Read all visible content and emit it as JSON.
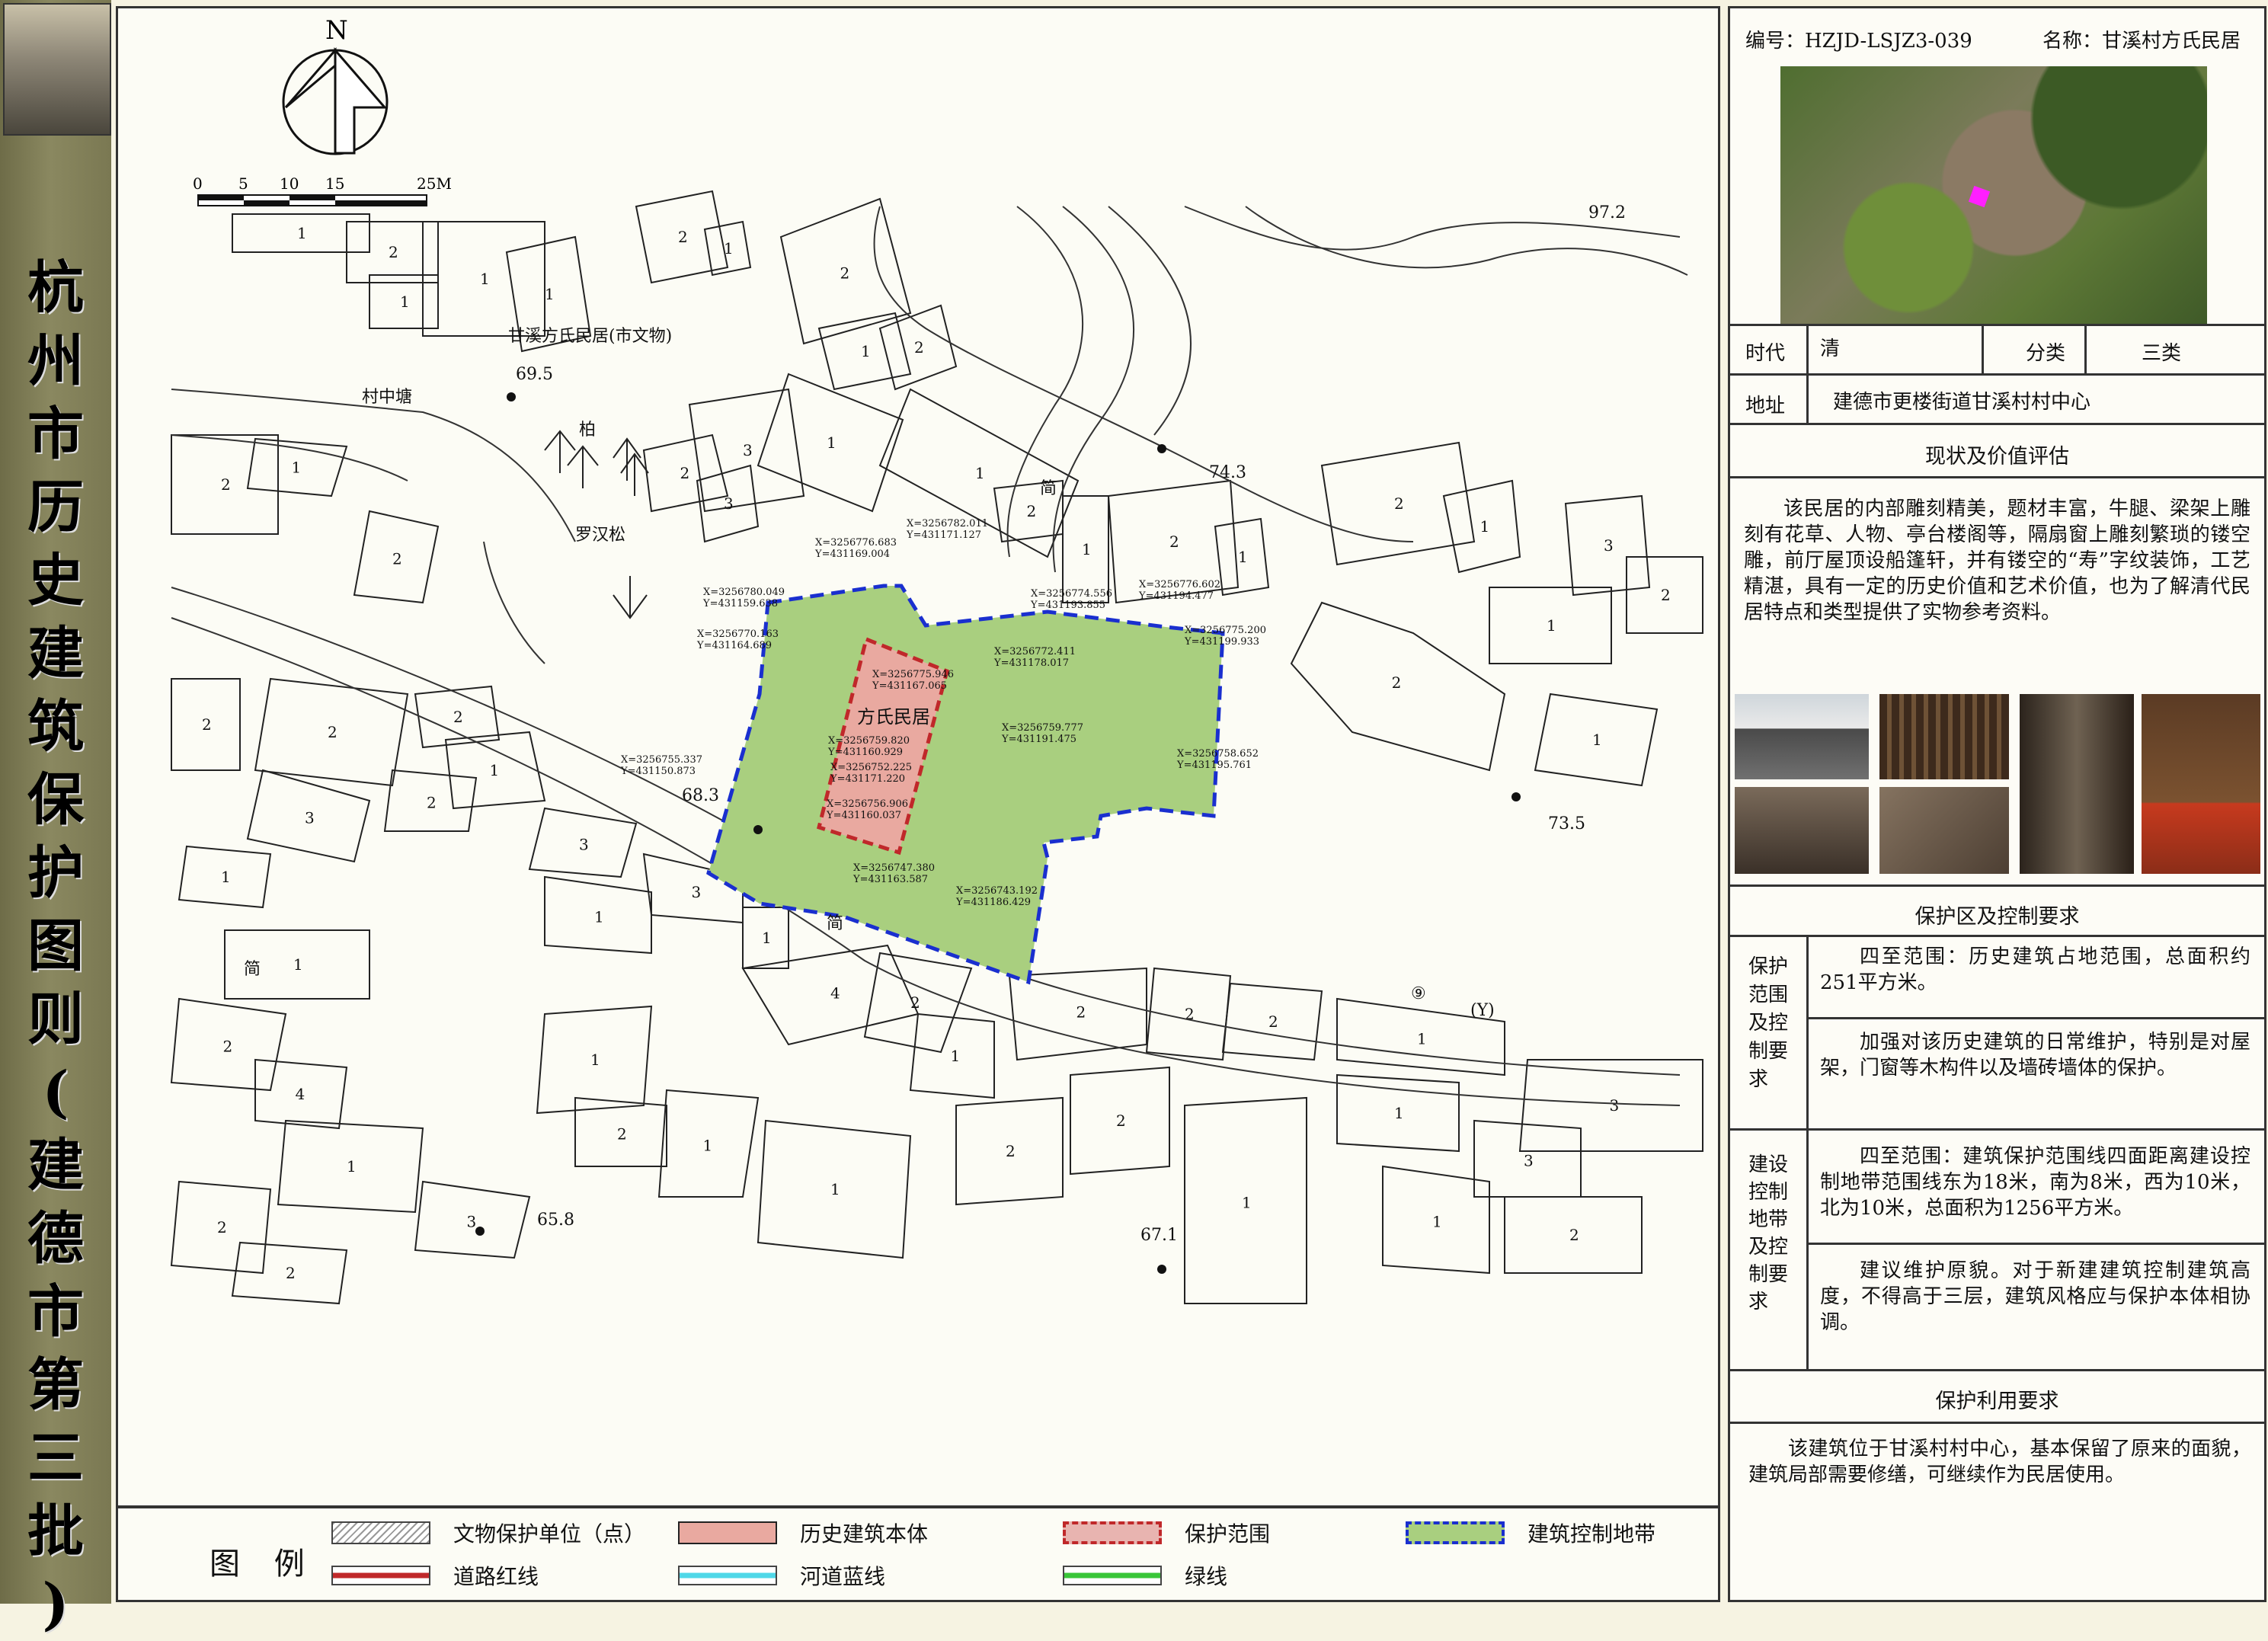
{
  "strip": {
    "title_chars": [
      "杭",
      "州",
      "市",
      "历",
      "史",
      "建",
      "筑",
      "保",
      "护",
      "图",
      "则",
      "(",
      "建",
      "德",
      "市",
      "第",
      "三",
      "批",
      ")"
    ]
  },
  "map": {
    "north": "N",
    "scale": {
      "ticks": [
        "0",
        "5",
        "10",
        "15"
      ],
      "end": "25M"
    },
    "place_labels": {
      "heritage_site": "甘溪方氏民居(市文物)",
      "pond": "村中塘",
      "arhat_pine": "罗汉松",
      "cypress": "柏",
      "building": "方氏民居",
      "jian1": "简",
      "jian2": "简",
      "jian3": "简",
      "road_num": "⑨",
      "road_y": "(Y)"
    },
    "elevations": [
      "69.5",
      "74.3",
      "97.2",
      "73.5",
      "68.3",
      "65.8",
      "67.1"
    ],
    "coords": [
      "X=3256782.011\nY=431171.127",
      "X=3256776.683\nY=431169.004",
      "X=3256780.049\nY=431159.638",
      "X=3256770.163\nY=431164.689",
      "X=3256774.556\nY=431193.855",
      "X=3256776.602\nY=431194.477",
      "X=3256775.200\nY=431199.933",
      "X=3256775.946\nY=431167.065",
      "X=3256772.411\nY=431178.017",
      "X=3256759.777\nY=431191.475",
      "X=3256758.652\nY=431195.761",
      "X=3256755.337\nY=431150.873",
      "X=3256759.820\nY=431160.929",
      "X=3256752.225\nY=431171.220",
      "X=3256756.906\nY=431160.037",
      "X=3256747.380\nY=431163.587",
      "X=3256743.192\nY=431186.429"
    ]
  },
  "legend": {
    "title": "图 例",
    "items": [
      {
        "label": "文物保护单位（点）"
      },
      {
        "label": "历史建筑本体"
      },
      {
        "label": "保护范围"
      },
      {
        "label": "建筑控制地带"
      },
      {
        "label": "道路红线"
      },
      {
        "label": "河道蓝线"
      },
      {
        "label": "绿线"
      }
    ],
    "colors": {
      "body": "#e9a9a0",
      "body_border": "#222",
      "protect": "#e8b4b0",
      "protect_border": "#c0282a",
      "control": "#a9cf7f",
      "control_border": "#1a2fcf",
      "road": "#c0282a",
      "river": "#4fd8e8",
      "green": "#39c639"
    }
  },
  "info": {
    "code": "编号：HZJD-LSJZ3-039",
    "name": "名称：甘溪村方氏民居",
    "era_label": "时代",
    "era_value": "清",
    "class_label": "分类",
    "class_value": "三类",
    "addr_label": "地址",
    "addr_value": "建德市更楼街道甘溪村村中心",
    "status_title": "现状及价值评估",
    "status_text": "该民居的内部雕刻精美，题材丰富，牛腿、梁架上雕刻有花草、人物、亭台楼阁等，隔扇窗上雕刻繁琐的镂空雕，前厅屋顶设船篷轩，并有镂空的“寿”字纹装饰，工艺精湛，具有一定的历史价值和艺术价值，也为了解清代民居特点和类型提供了实物参考资料。",
    "zone_title": "保护区及控制要求",
    "protect_label": "保护范围及控制要求",
    "protect_text1": "四至范围：历史建筑占地范围，总面积约251平方米。",
    "protect_text2": "加强对该历史建筑的日常维护，特别是对屋架，门窗等木构件以及墙砖墙体的保护。",
    "control_label": "建设控制地带及控制要求",
    "control_text1": "四至范围：建筑保护范围线四面距离建设控制地带范围线东为18米，南为8米，西为10米，北为10米，总面积为1256平方米。",
    "control_text2": "建议维护原貌。对于新建建筑控制建筑高度，不得高于三层，建筑风格应与保护本体相协调。",
    "use_title": "保护利用要求",
    "use_text": "该建筑位于甘溪村村中心，基本保留了原来的面貌，建筑局部需要修缮，可继续作为民居使用。"
  }
}
